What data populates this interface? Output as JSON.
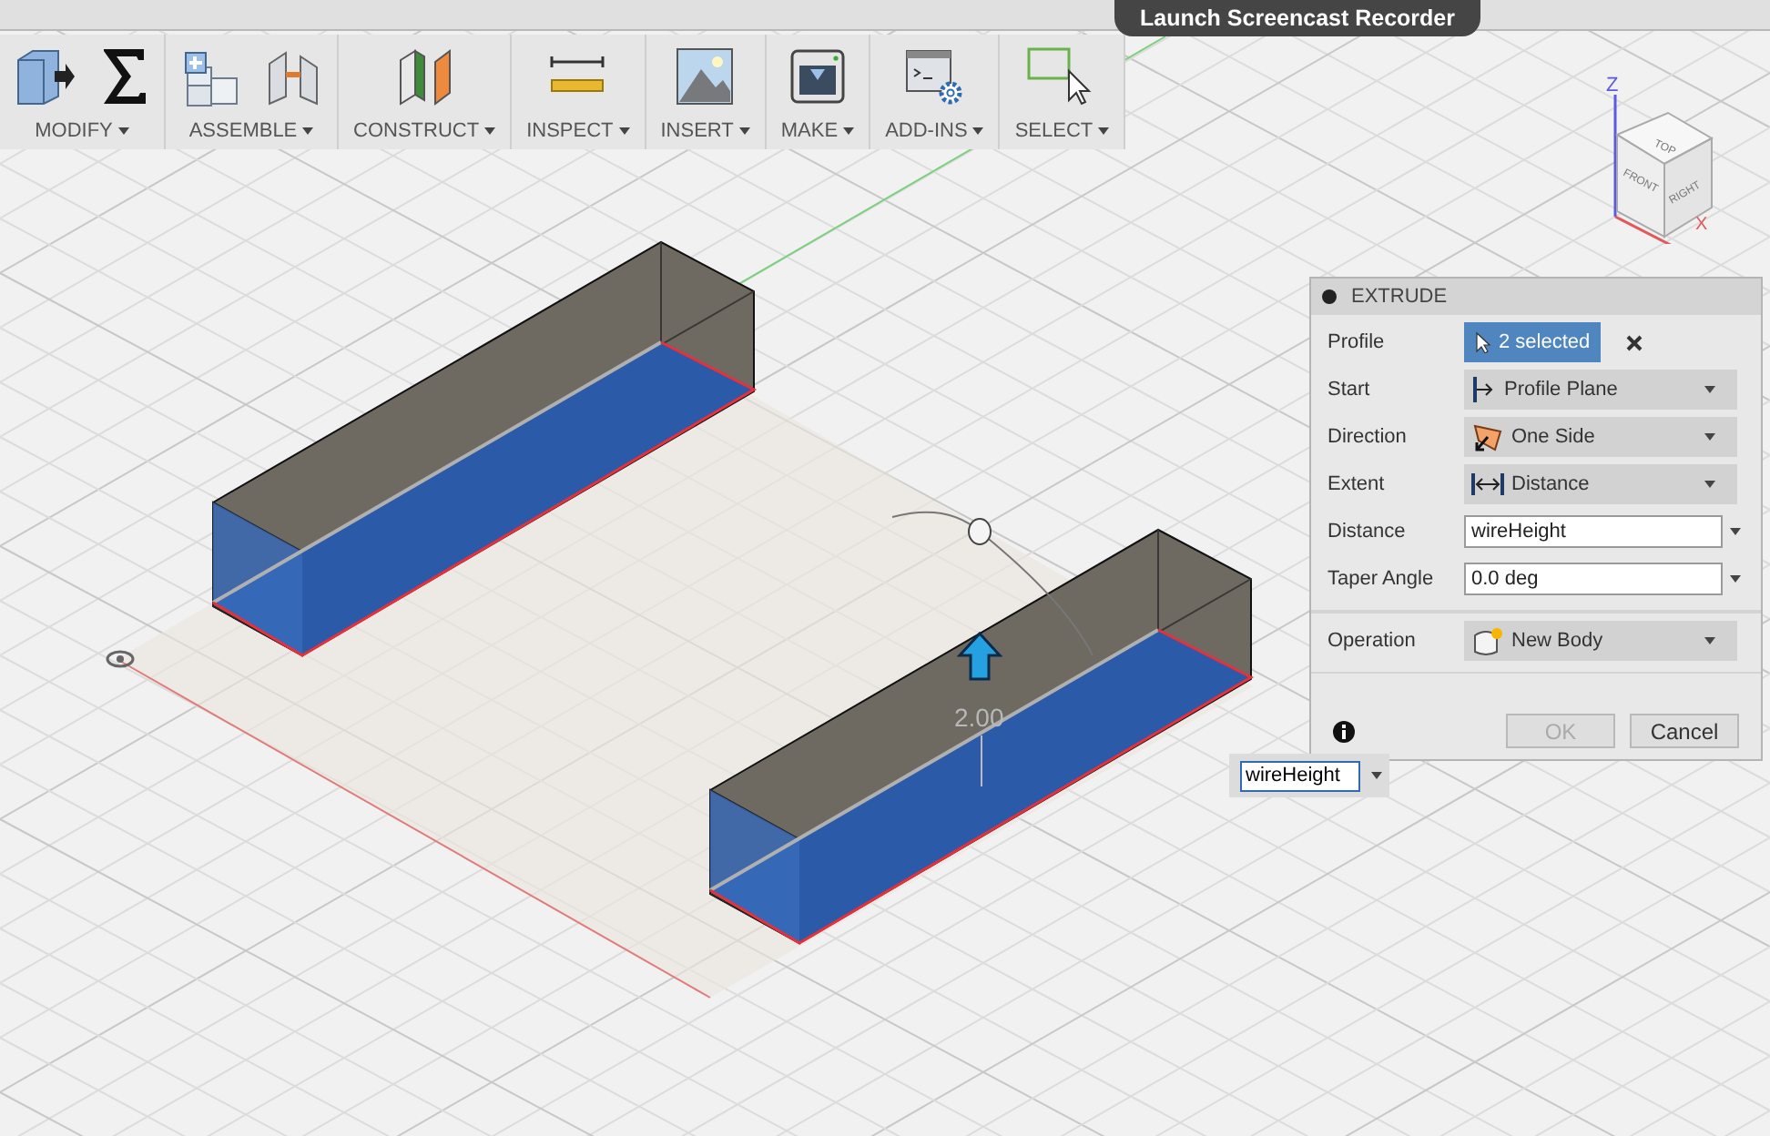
{
  "top_bar": {
    "tooltip": "Launch Screencast Recorder"
  },
  "toolbar": [
    {
      "label": "MODIFY"
    },
    {
      "label": "ASSEMBLE"
    },
    {
      "label": "CONSTRUCT"
    },
    {
      "label": "INSPECT"
    },
    {
      "label": "INSERT"
    },
    {
      "label": "MAKE"
    },
    {
      "label": "ADD-INS"
    },
    {
      "label": "SELECT"
    }
  ],
  "view_cube": {
    "top": "TOP",
    "front": "FRONT",
    "right": "RIGHT",
    "z_label": "Z",
    "x_label": "X"
  },
  "viewport": {
    "dimension": "2.00",
    "distance_input": "wireHeight"
  },
  "extrude": {
    "title": "EXTRUDE",
    "sections": [
      {
        "rows": [
          {
            "label": "Profile",
            "kind": "selection",
            "value": "2 selected"
          },
          {
            "label": "Start",
            "kind": "dropdown",
            "value": "Profile Plane"
          },
          {
            "label": "Direction",
            "kind": "dropdown",
            "value": "One Side"
          },
          {
            "label": "Extent",
            "kind": "dropdown",
            "value": "Distance"
          },
          {
            "label": "Distance",
            "kind": "input",
            "value": "wireHeight"
          },
          {
            "label": "Taper Angle",
            "kind": "input",
            "value": "0.0 deg"
          }
        ]
      },
      {
        "rows": [
          {
            "label": "Operation",
            "kind": "dropdown",
            "value": "New Body"
          }
        ]
      }
    ],
    "buttons": [
      {
        "label": "OK",
        "disabled": true
      },
      {
        "label": "Cancel",
        "disabled": false
      }
    ]
  }
}
